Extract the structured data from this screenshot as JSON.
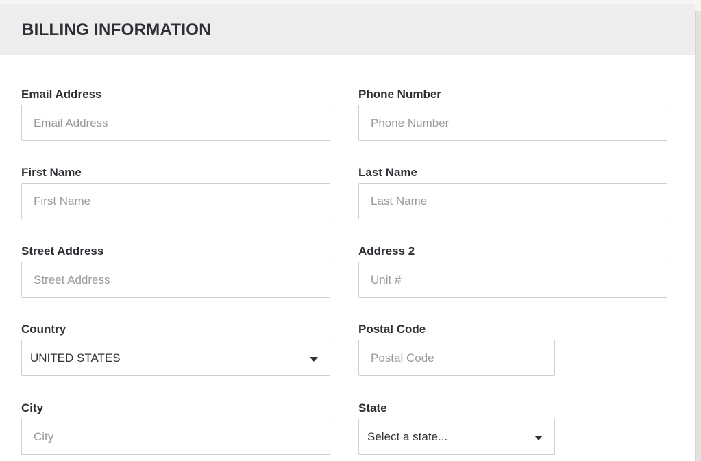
{
  "header": {
    "title": "BILLING INFORMATION"
  },
  "fields": {
    "email": {
      "label": "Email Address",
      "placeholder": "Email Address",
      "value": ""
    },
    "phone": {
      "label": "Phone Number",
      "placeholder": "Phone Number",
      "value": ""
    },
    "first_name": {
      "label": "First Name",
      "placeholder": "First Name",
      "value": ""
    },
    "last_name": {
      "label": "Last Name",
      "placeholder": "Last Name",
      "value": ""
    },
    "street": {
      "label": "Street Address",
      "placeholder": "Street Address",
      "value": ""
    },
    "address2": {
      "label": "Address 2",
      "placeholder": "Unit #",
      "value": ""
    },
    "country": {
      "label": "Country",
      "selected": "UNITED STATES",
      "icon": "caret-down-icon"
    },
    "postal": {
      "label": "Postal Code",
      "placeholder": "Postal Code",
      "value": ""
    },
    "city": {
      "label": "City",
      "placeholder": "City",
      "value": ""
    },
    "state": {
      "label": "State",
      "selected": "Select a state...",
      "icon": "caret-down-icon"
    }
  }
}
